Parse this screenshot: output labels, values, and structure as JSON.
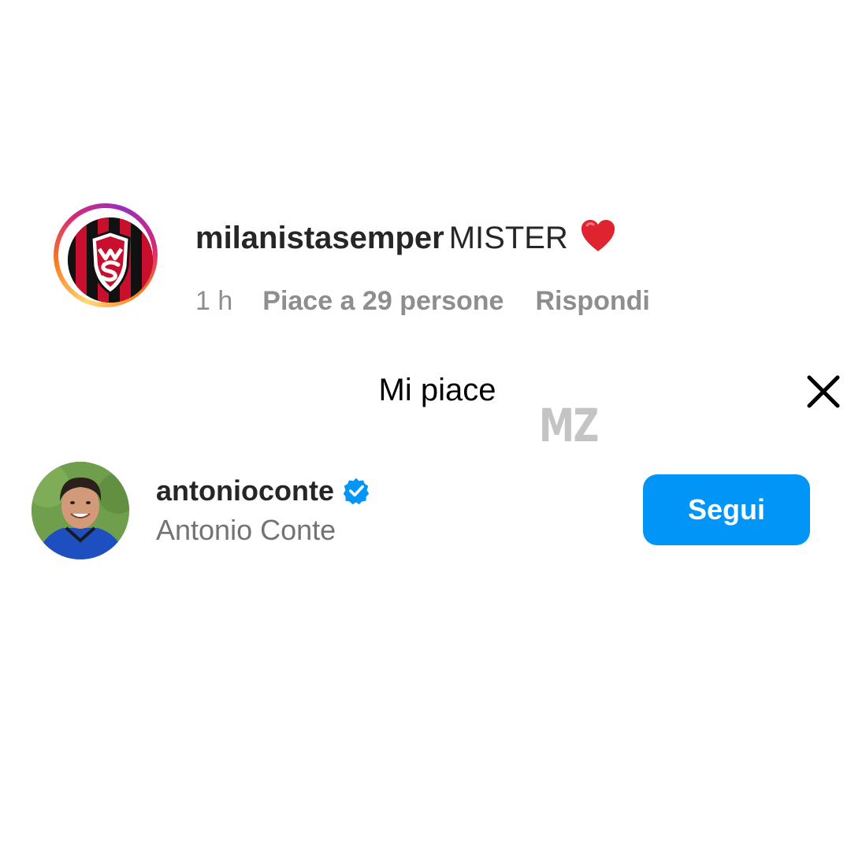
{
  "comment": {
    "username": "milanistasemper",
    "text": "MISTER",
    "emoji_icon": "red-heart-icon",
    "time": "1 h",
    "likes": "Piace a 29 persone",
    "reply_label": "Rispondi"
  },
  "likes_panel": {
    "title": "Mi piace",
    "close_icon": "close-icon",
    "watermark": "MZ",
    "users": [
      {
        "handle": "antonioconte",
        "full_name": "Antonio Conte",
        "verified": true,
        "follow_label": "Segui"
      }
    ]
  },
  "colors": {
    "follow_button": "#0095f6",
    "verified_badge": "#0095f6",
    "heart": "#ed4956",
    "secondary_text": "#8e8e8e"
  }
}
